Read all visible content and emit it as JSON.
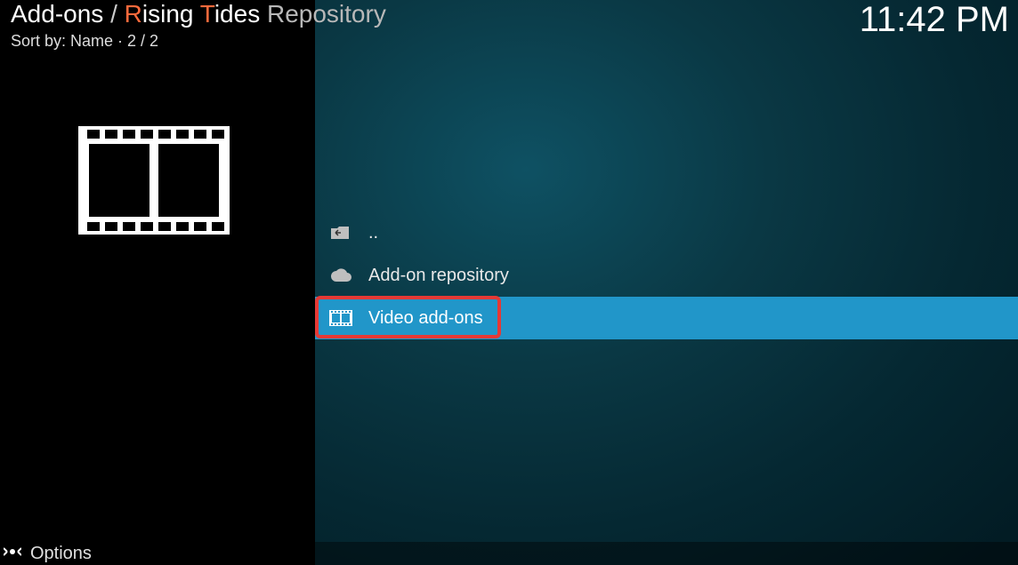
{
  "header": {
    "breadcrumb_prefix": "Add-ons",
    "breadcrumb_sep": " / ",
    "repo_word1_first": "R",
    "repo_word1_rest": "ising",
    "repo_word2_first": "T",
    "repo_word2_rest": "ides",
    "repo_suffix": " Repository",
    "sort_label": "Sort by: ",
    "sort_value": "Name",
    "sort_sep": "  ·  ",
    "position": "2 / 2",
    "clock": "11:42 PM"
  },
  "list": {
    "items": [
      {
        "icon": "folder-up-icon",
        "label": ".."
      },
      {
        "icon": "cloud-icon",
        "label": "Add-on repository"
      },
      {
        "icon": "film-icon",
        "label": "Video add-ons",
        "selected": true,
        "highlight": true
      }
    ]
  },
  "footer": {
    "options_label": "Options"
  }
}
